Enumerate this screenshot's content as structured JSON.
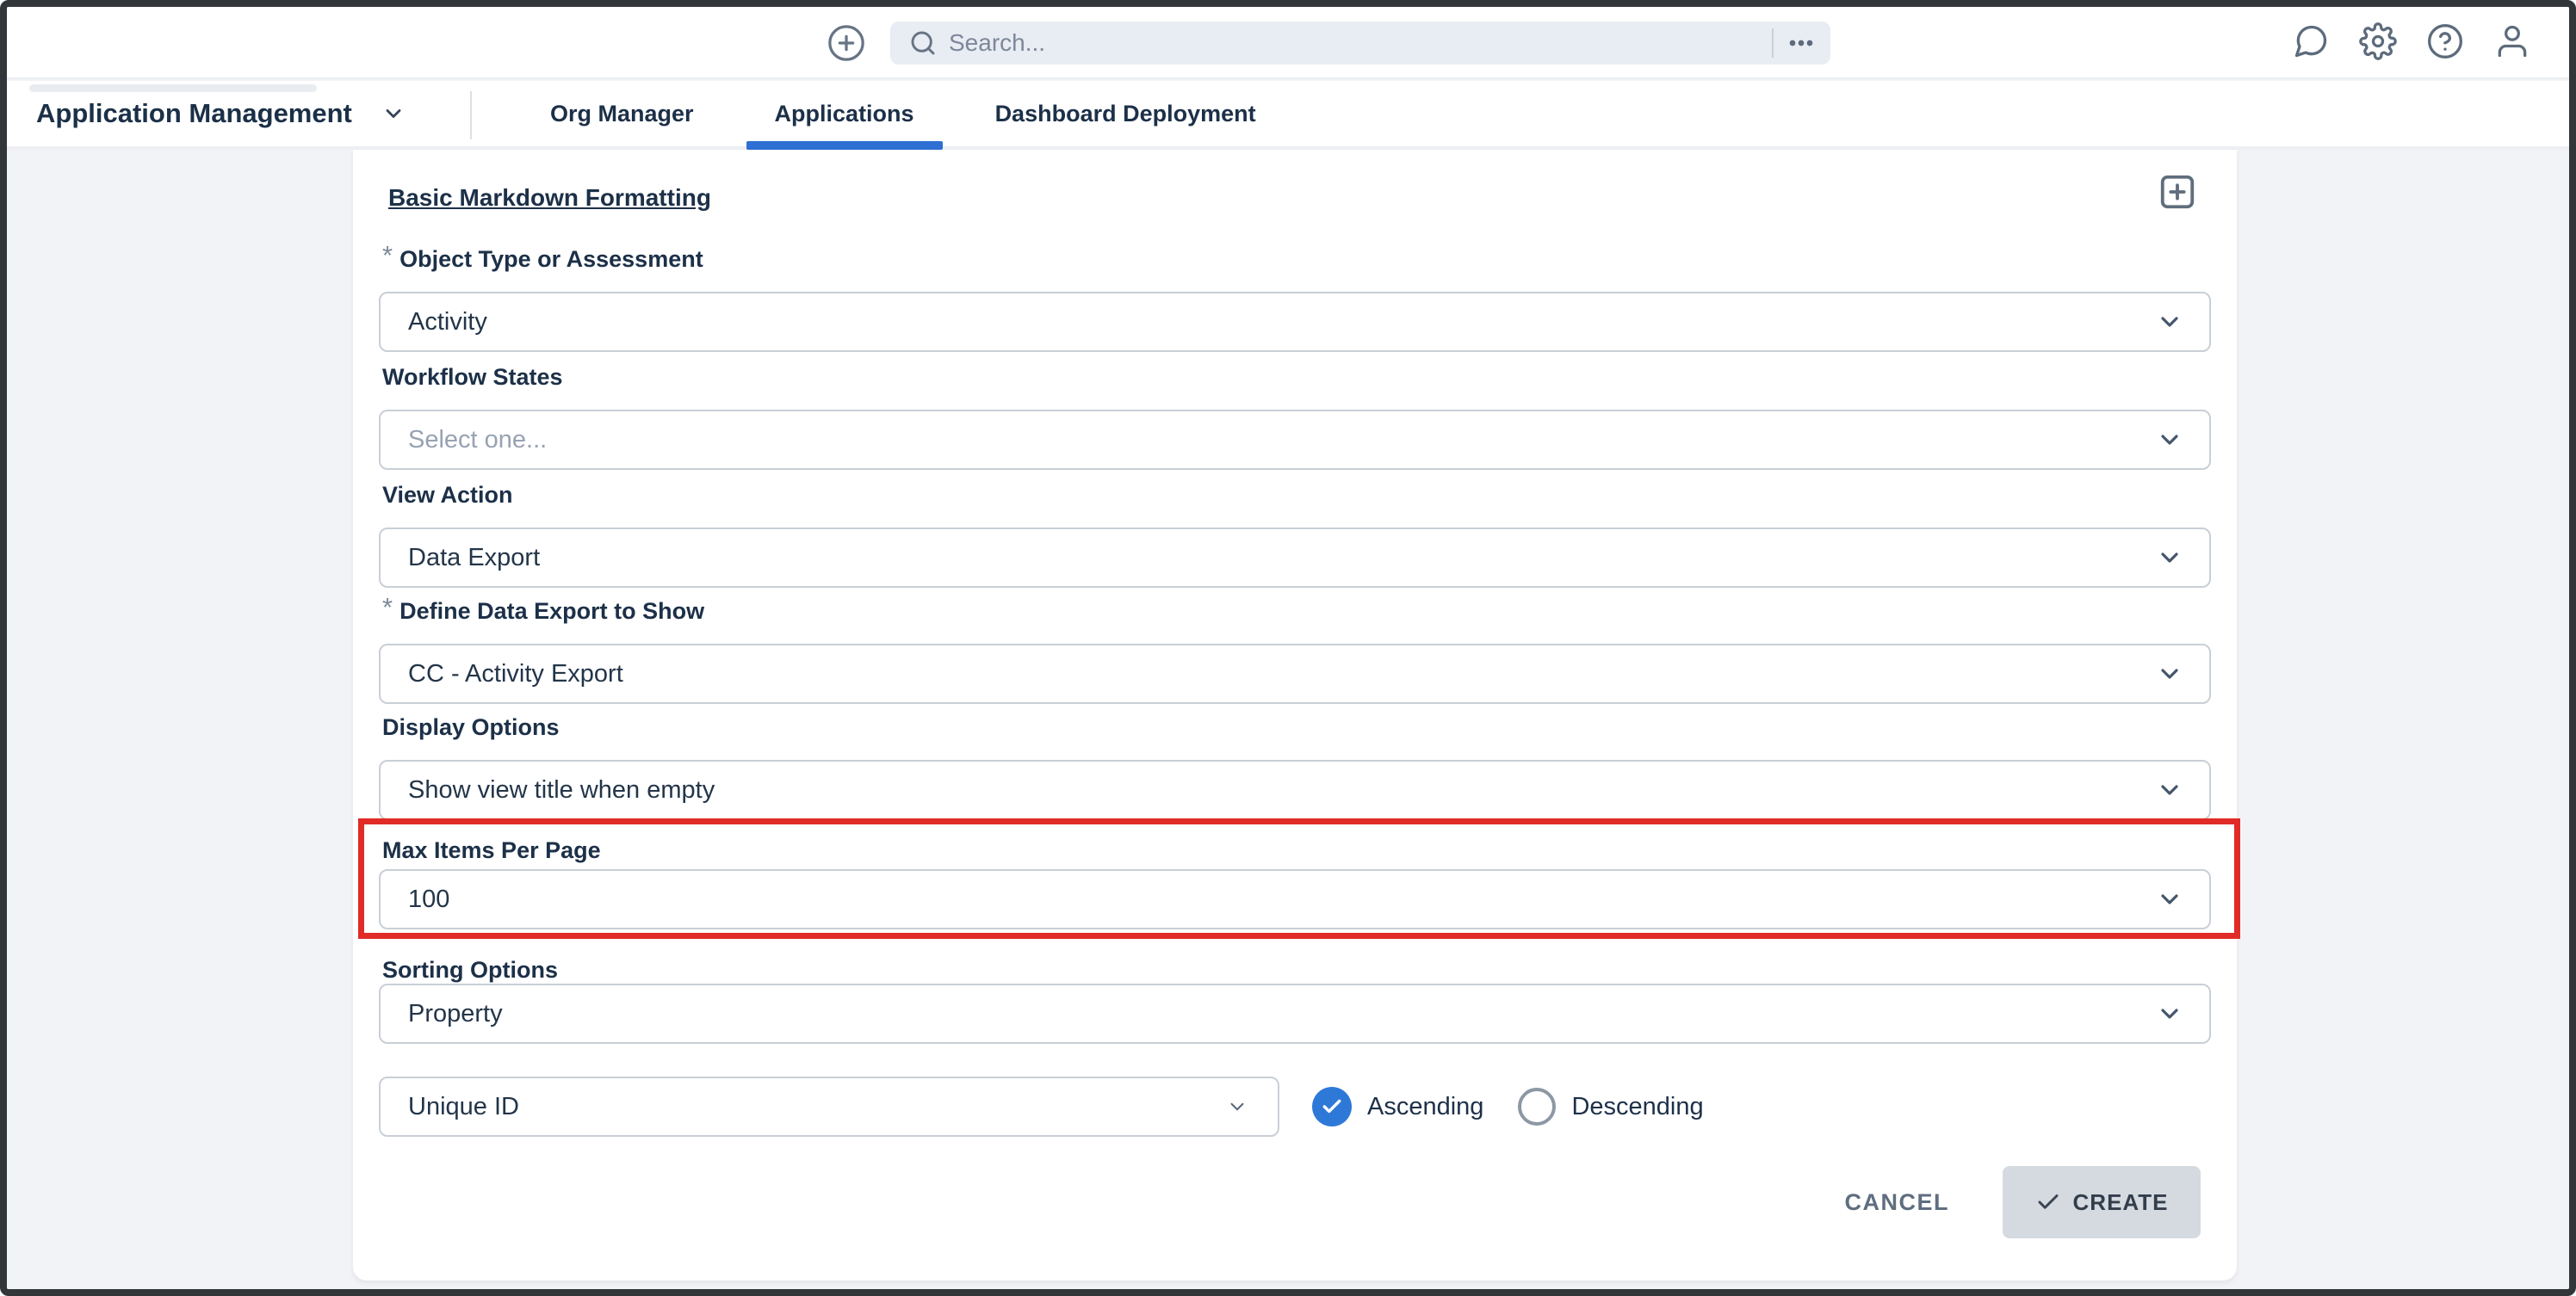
{
  "topbar": {
    "search": {
      "placeholder": "Search..."
    },
    "icons": [
      "plus-circle-icon",
      "search-icon",
      "ellipsis-icon",
      "chat-icon",
      "gear-icon",
      "help-icon",
      "user-icon"
    ]
  },
  "nav": {
    "app_switcher": "Application Management",
    "tabs": [
      {
        "label": "Org Manager",
        "active": false
      },
      {
        "label": "Applications",
        "active": true
      },
      {
        "label": "Dashboard Deployment",
        "active": false
      }
    ],
    "active_tab_color": "#2d6fd2"
  },
  "form": {
    "title": "Basic Markdown Formatting",
    "required_marker": "*",
    "fields": [
      {
        "label": "Object Type or Assessment",
        "required": true,
        "value": "Activity"
      },
      {
        "label": "Workflow States",
        "required": false,
        "placeholder": "Select one..."
      },
      {
        "label": "View Action",
        "required": false,
        "value": "Data Export"
      },
      {
        "label": "Define Data Export to Show",
        "required": true,
        "value": "CC - Activity Export"
      },
      {
        "label": "Display Options",
        "required": false,
        "value": "Show view title when empty"
      },
      {
        "label": "Max Items Per Page",
        "required": false,
        "value": "100",
        "highlighted": true
      },
      {
        "label": "Sorting Options",
        "required": false,
        "value": "Property"
      }
    ],
    "sort_property": {
      "value": "Unique ID"
    },
    "sort_direction": [
      {
        "label": "Ascending",
        "selected": true
      },
      {
        "label": "Descending",
        "selected": false
      }
    ],
    "actions": {
      "cancel": "CANCEL",
      "create": "CREATE"
    },
    "highlight_color": "#e02b26"
  }
}
